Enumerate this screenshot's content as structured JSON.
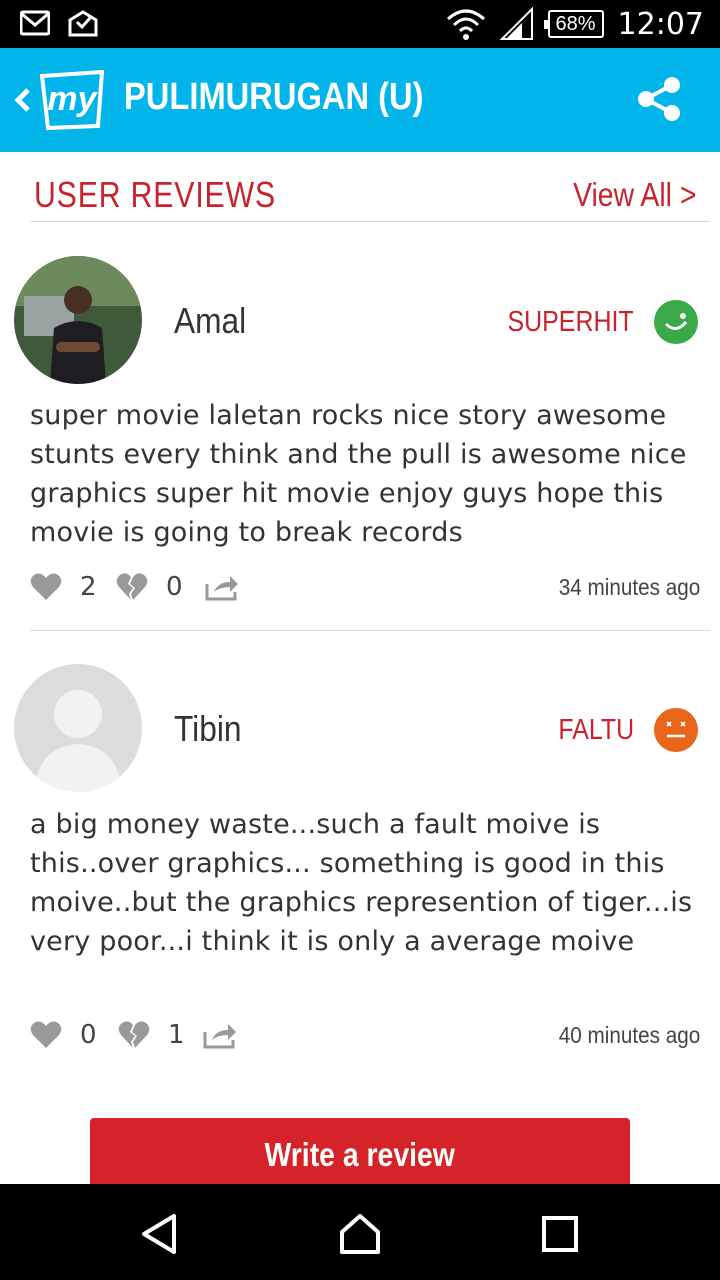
{
  "status_bar": {
    "icons": [
      "gmail-icon",
      "mail-check-icon",
      "wifi-icon",
      "signal-icon"
    ],
    "battery": "68%",
    "time": "12:07"
  },
  "app_bar": {
    "logo_text": "my",
    "title": "PULIMURUGAN (U)",
    "back_icon": "chevron-left-icon",
    "share_icon": "share-icon"
  },
  "section": {
    "title": "USER REVIEWS",
    "view_all": "View All >"
  },
  "reviews": [
    {
      "name": "Amal",
      "verdict": "SUPERHIT",
      "verdict_color": "#3aa94a",
      "text": "super movie laletan rocks nice story awesome stunts every think and the pull is awesome nice graphics super hit movie enjoy guys hope this movie is going to break records",
      "likes": "2",
      "dislikes": "0",
      "time": "34 minutes ago"
    },
    {
      "name": "Tibin",
      "verdict": "FALTU",
      "verdict_color": "#e8661c",
      "text": "a big money waste...such a fault moive is this..over graphics... something is good in this moive..but the graphics represention of tiger...is very poor...i think it is only a average moive",
      "likes": "0",
      "dislikes": "1",
      "time": "40 minutes ago"
    }
  ],
  "write_review": "Write a review",
  "nav": [
    "back-icon",
    "home-icon",
    "recents-icon"
  ],
  "colors": {
    "brand_blue": "#01b5ea",
    "accent_red": "#c8232c"
  }
}
